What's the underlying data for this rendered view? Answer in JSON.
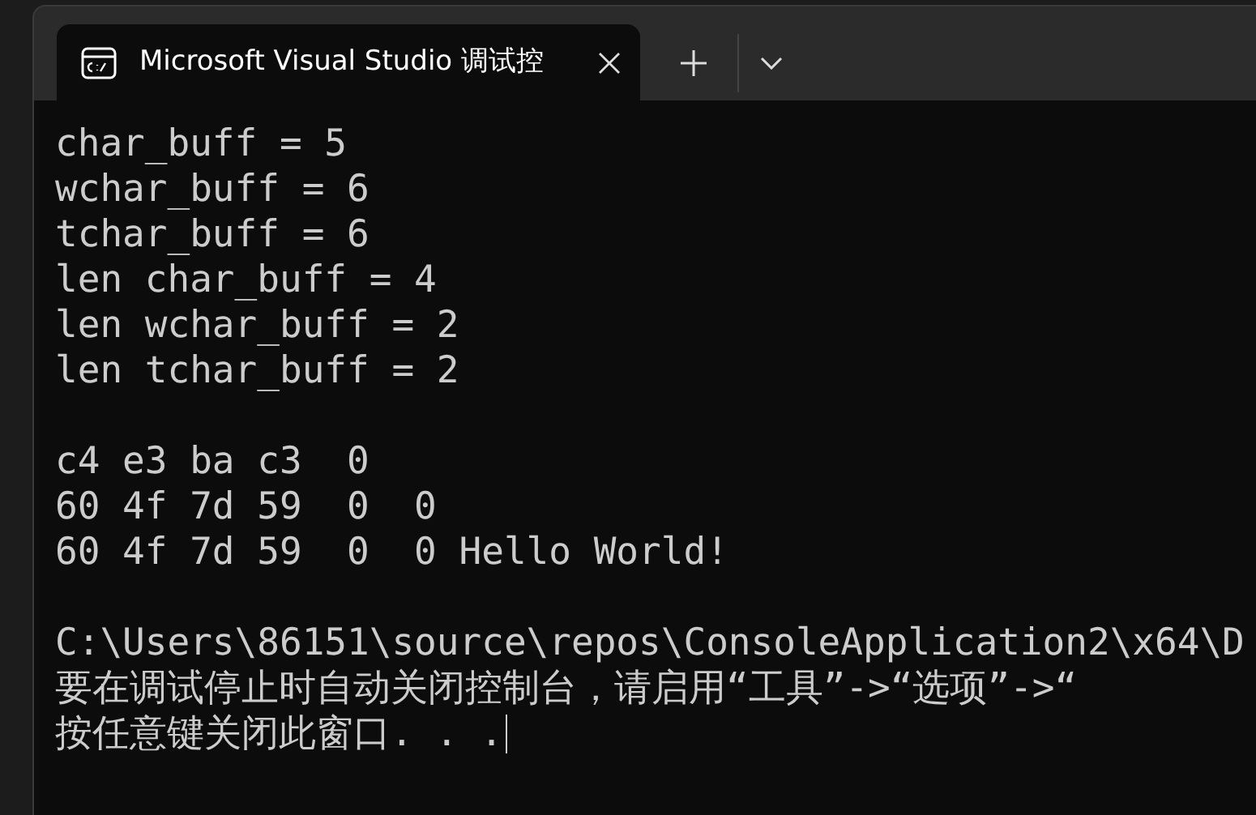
{
  "tab": {
    "title": "Microsoft Visual Studio 调试控",
    "selected": true
  },
  "console": {
    "blocks": [
      {
        "lines": [
          "char_buff = 5",
          "wchar_buff = 6",
          "tchar_buff = 6",
          "len char_buff = 4",
          "len wchar_buff = 2",
          "len tchar_buff = 2"
        ]
      },
      {
        "lines": [
          "c4 e3 ba c3  0",
          "60 4f 7d 59  0  0",
          "60 4f 7d 59  0  0 Hello World!"
        ]
      },
      {
        "lines": [
          "C:\\Users\\86151\\source\\repos\\ConsoleApplication2\\x64\\D",
          "要在调试停止时自动关闭控制台，请启用“工具”->“选项”->“",
          "按任意键关闭此窗口. . ."
        ]
      }
    ]
  }
}
